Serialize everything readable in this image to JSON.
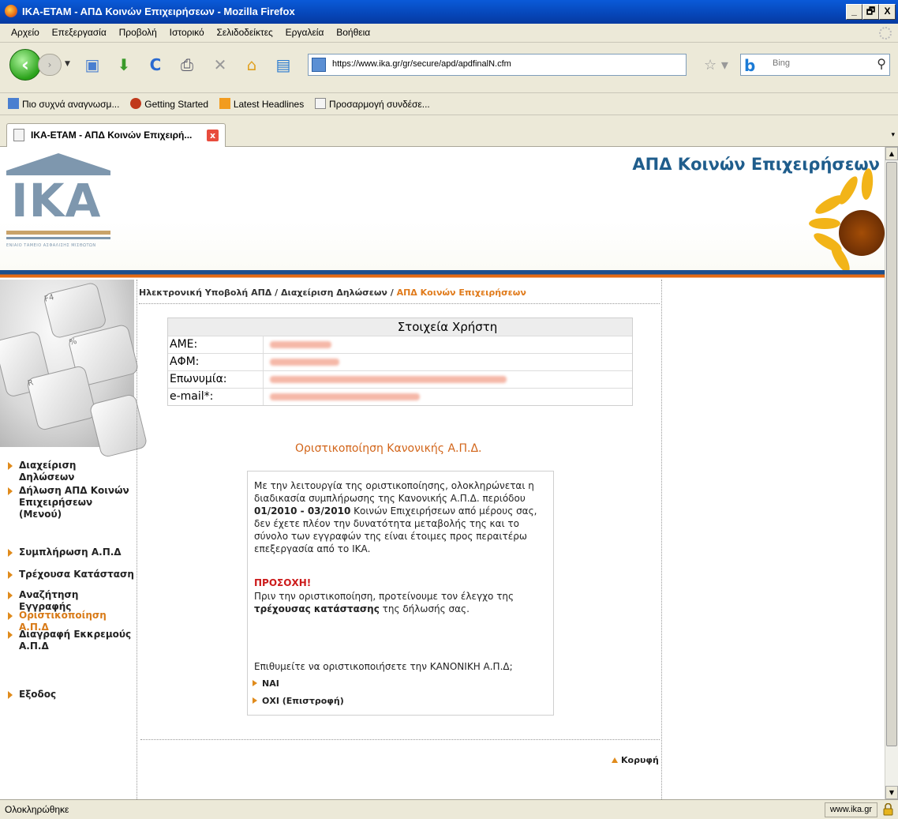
{
  "window": {
    "title": "ΙΚΑ-ΕΤΑΜ - ΑΠΔ Κοινών Επιχειρήσεων - Mozilla Firefox",
    "controls": [
      "_",
      "🗗",
      "X"
    ]
  },
  "menu": [
    "Αρχείο",
    "Επεξεργασία",
    "Προβολή",
    "Ιστορικό",
    "Σελιδοδείκτες",
    "Εργαλεία",
    "Βοήθεια"
  ],
  "navbar": {
    "url": "https://www.ika.gr/gr/secure/apd/apdfinalN.cfm",
    "search_placeholder": "Bing",
    "icons": [
      "back-icon",
      "forward-icon",
      "bookmark-icon",
      "download-icon",
      "reload-icon",
      "print-icon",
      "stop-icon",
      "home-icon",
      "newtab-icon"
    ]
  },
  "bookmarks": [
    "Πιο συχνά αναγνωσμ...",
    "Getting Started",
    "Latest Headlines",
    "Προσαρμογή συνδέσε..."
  ],
  "tab": {
    "title": "ΙΚΑ-ΕΤΑΜ - ΑΠΔ Κοινών Επιχειρή..."
  },
  "site": {
    "logo_text": "ΙΚΑ",
    "logo_caption": "ΕΝΙΑΙΟ ΤΑΜΕΙΟ ΑΣΦΑΛΙΣΗΣ ΜΙΣΘΩΤΩΝ",
    "header_title": "ΑΠΔ Κοινών Επιχειρήσεων"
  },
  "breadcrumb": {
    "part1": "Ηλεκτρονική Υποβολή ΑΠΔ",
    "sep": " / ",
    "part2": "Διαχείριση Δηλώσεων",
    "current": "ΑΠΔ Κοινών Επιχειρήσεων"
  },
  "sidebar": {
    "items": [
      {
        "label": "Διαχείριση Δηλώσεων",
        "active": false
      },
      {
        "label": "Δήλωση ΑΠΔ Κοινών Επιχειρήσεων (Μενού)",
        "active": false
      },
      {
        "label": "Συμπλήρωση Α.Π.Δ",
        "active": false
      },
      {
        "label": "Τρέχουσα Κατάσταση",
        "active": false
      },
      {
        "label": "Αναζήτηση Εγγραφής",
        "active": false
      },
      {
        "label": "Οριστικοποίηση Α.Π.Δ",
        "active": true
      },
      {
        "label": "Διαγραφή Εκκρεμούς Α.Π.Δ",
        "active": false
      },
      {
        "label": "Εξοδος",
        "active": false
      }
    ]
  },
  "user_info": {
    "heading": "Στοιχεία Χρήστη",
    "fields": [
      {
        "label": "ΑΜΕ:"
      },
      {
        "label": "ΑΦΜ:"
      },
      {
        "label": "Επωνυμία:"
      },
      {
        "label": "e-mail*:"
      }
    ]
  },
  "finalize": {
    "title": "Οριστικοποίηση Κανονικής Α.Π.Δ.",
    "para_before": "Με την λειτουργία της οριστικοποίησης, ολοκληρώνεται η διαδικασία συμπλήρωσης της Κανονικής Α.Π.Δ. περιόδου",
    "period": "01/2010 - 03/2010",
    "para_after": "Κοινών Επιχειρήσεων από μέρους σας, δεν έχετε πλέον την δυνατότητα μεταβολής της και το σύνολο των εγγραφών της είναι έτοιμες προς περαιτέρω επεξεργασία από το ΙΚΑ.",
    "warning_title": "ΠΡΟΣΟΧΗ!",
    "warning_before": "Πριν την οριστικοποίηση, προτείνουμε τον έλεγχο της",
    "warning_bold": "τρέχουσας κατάστασης",
    "warning_after": "της δήλωσής σας.",
    "question": "Επιθυμείτε να οριστικοποιήσετε την ΚΑΝΟΝΙΚΗ Α.Π.Δ;",
    "yes": "ΝΑΙ",
    "no": "ΟΧΙ (Επιστροφή)"
  },
  "top_link": "Κορυφή",
  "statusbar": {
    "status": "Ολοκληρώθηκε",
    "domain": "www.ika.gr"
  },
  "colors": {
    "accent_orange": "#e07a1a",
    "header_blue": "#1f5d8c",
    "warning_red": "#cc1a1a"
  }
}
